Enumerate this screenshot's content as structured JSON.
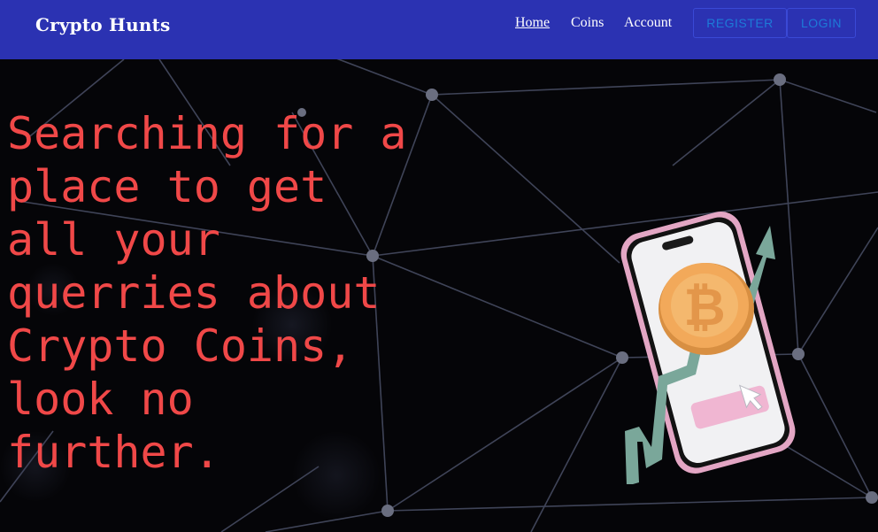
{
  "navbar": {
    "brand": "Crypto Hunts",
    "links": [
      {
        "label": "Home",
        "active": true
      },
      {
        "label": "Coins",
        "active": false
      },
      {
        "label": "Account",
        "active": false
      }
    ],
    "register_label": "REGISTER",
    "login_label": "LOGIN"
  },
  "hero": {
    "headline": "Searching for a place to get all your querries about Crypto Coins, look no further."
  },
  "colors": {
    "navbar_bg": "#2b32b2",
    "headline": "#f04848",
    "button_text": "#1d7ad8",
    "hero_bg": "#050508"
  },
  "icons": [
    "bitcoin-coin-icon",
    "trend-arrow-icon",
    "cursor-icon",
    "smartphone-illustration"
  ]
}
